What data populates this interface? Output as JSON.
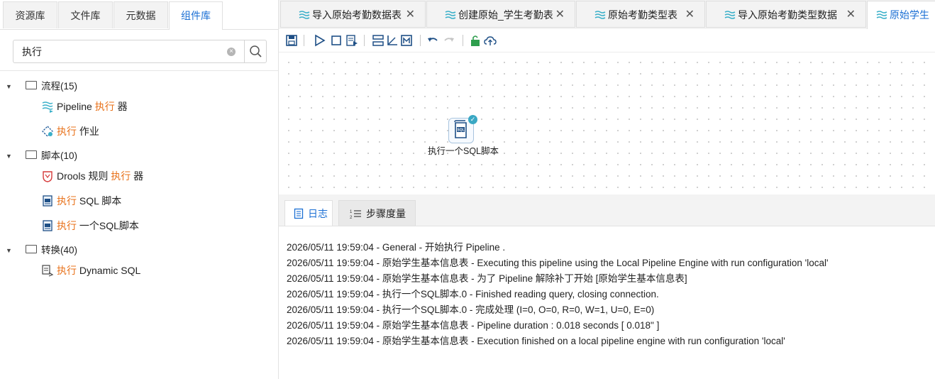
{
  "left_tabs": [
    "资源库",
    "文件库",
    "元数据",
    "组件库"
  ],
  "active_left_tab": "组件库",
  "search": {
    "value": "执行",
    "placeholder": ""
  },
  "tree": {
    "cat1": {
      "label": "流程(15)"
    },
    "cat1_item1": {
      "pre": "Pipeline ",
      "hl": "执行",
      "post": " 器"
    },
    "cat1_item2": {
      "pre": "",
      "hl": "执行",
      "post": " 作业"
    },
    "cat2": {
      "label": "脚本(10)"
    },
    "cat2_item1": {
      "pre": "Drools 规则 ",
      "hl": "执行",
      "post": " 器"
    },
    "cat2_item2": {
      "pre": "",
      "hl": "执行",
      "post": " SQL 脚本"
    },
    "cat2_item3": {
      "pre": "",
      "hl": "执行",
      "post": " 一个SQL脚本"
    },
    "cat3": {
      "label": "转换(40)"
    },
    "cat3_item1": {
      "pre": "",
      "hl": "执行",
      "post": " Dynamic SQL"
    }
  },
  "doc_tabs": [
    "导入原始考勤数据表",
    "创建原始_学生考勤表",
    "原始考勤类型表",
    "导入原始考勤类型数据",
    "原始学生"
  ],
  "canvas": {
    "node_label": "执行一个SQL脚本"
  },
  "bottom_tabs": {
    "log": "日志",
    "metrics": "步骤度量"
  },
  "log_lines": [
    "2026/05/11 19:59:04 - General - 开始执行 Pipeline .",
    "2026/05/11 19:59:04 - 原始学生基本信息表 - Executing this pipeline using the Local Pipeline Engine with run configuration 'local'",
    "2026/05/11 19:59:04 - 原始学生基本信息表 - 为了 Pipeline 解除补丁开始 [原始学生基本信息表]",
    "2026/05/11 19:59:04 - 执行一个SQL脚本.0 - Finished reading query, closing connection.",
    "2026/05/11 19:59:04 - 执行一个SQL脚本.0 - 完成处理 (I=0, O=0, R=0, W=1, U=0, E=0)",
    "2026/05/11 19:59:04 - 原始学生基本信息表 - Pipeline duration : 0.018 seconds [  0.018\" ]",
    "2026/05/11 19:59:04 - 原始学生基本信息表 - Execution finished on a local pipeline engine with run configuration 'local'"
  ],
  "colors": {
    "accent": "#1b6fd4",
    "highlight": "#e8711a",
    "check": "#3aa8c4"
  }
}
